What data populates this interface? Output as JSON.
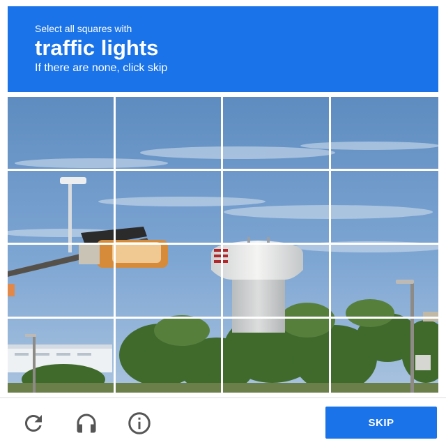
{
  "header": {
    "instruction_line1": "Select all squares with",
    "target_object": "traffic lights",
    "instruction_line3": "If there are none, click skip"
  },
  "grid": {
    "rows": 4,
    "columns": 4
  },
  "footer": {
    "reload_icon": "reload-icon",
    "audio_icon": "headphones-icon",
    "info_icon": "info-icon",
    "skip_label": "SKIP"
  },
  "colors": {
    "accent": "#1a73e8",
    "icon": "#555555"
  }
}
